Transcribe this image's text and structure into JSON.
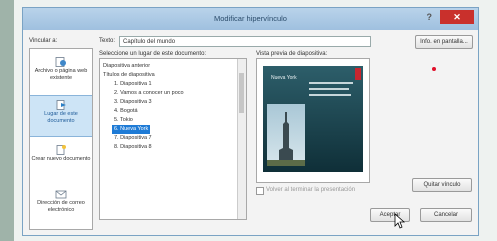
{
  "dialog": {
    "title": "Modificar hipervínculo",
    "help_label": "?",
    "close_label": "✕"
  },
  "link_to_label": "Vincular a:",
  "text_label": "Texto:",
  "text_value": "Capítulo del mundo",
  "tooltip_button": "Info. en pantalla...",
  "select_place_label": "Seleccione un lugar de este documento:",
  "preview_label": "Vista previa de diapositiva:",
  "left_panel": [
    {
      "label": "Archivo o página web existente",
      "icon": "globe-page-icon"
    },
    {
      "label": "Lugar de este documento",
      "icon": "document-place-icon"
    },
    {
      "label": "Crear nuevo documento",
      "icon": "new-document-icon"
    },
    {
      "label": "Dirección de correo electrónico",
      "icon": "email-icon"
    }
  ],
  "tree_items": [
    {
      "label": "Diapositiva anterior",
      "indent": 0
    },
    {
      "label": "Títulos de diapositiva",
      "indent": 0
    },
    {
      "label": "1. Diapositiva 1",
      "indent": 1
    },
    {
      "label": "2. Vamos a conocer un poco",
      "indent": 1
    },
    {
      "label": "3. Diapositiva 3",
      "indent": 1
    },
    {
      "label": "4. Bogotá",
      "indent": 1
    },
    {
      "label": "5. Tokio",
      "indent": 1
    },
    {
      "label": "6. Nueva York",
      "indent": 1,
      "selected": true
    },
    {
      "label": "7. Diapositiva 7",
      "indent": 1
    },
    {
      "label": "8. Diapositiva 8",
      "indent": 1
    }
  ],
  "slide_title": "Nueva York",
  "show_return_label": "Volver al terminar la presentación",
  "remove_link_button": "Quitar vínculo",
  "ok_button": "Aceptar",
  "cancel_button": "Cancelar"
}
